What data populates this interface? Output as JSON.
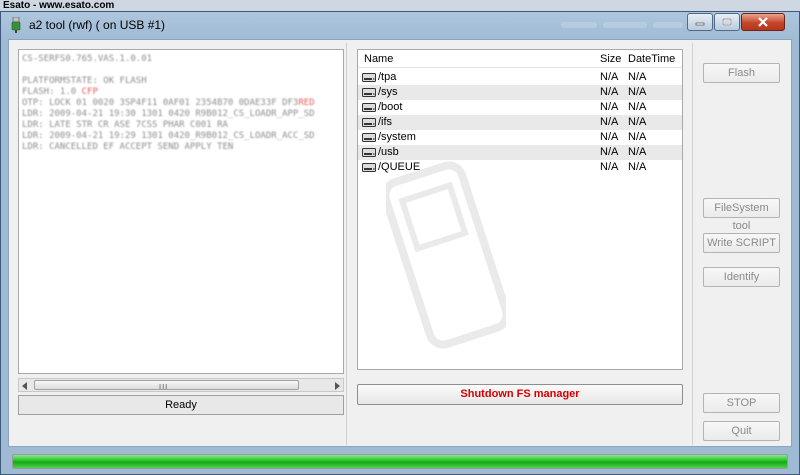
{
  "watermark": "Esato - www.esato.com",
  "window": {
    "title": "a2 tool (rwf) ( on USB #1)",
    "icon": "usb-plug-icon"
  },
  "log": {
    "lines": [
      {
        "text": "CS-SERFS0.765.VAS.1.0.01",
        "red": ""
      },
      {
        "text": "",
        "red": ""
      },
      {
        "text": "PLATFORMSTATE: OK FLASH",
        "red": ""
      },
      {
        "text": "FLASH: 1.0  ",
        "red": "CFP"
      },
      {
        "text": "OTP: LOCK 01 0020 3SP4F11 0AF01 2354B70 0DAE33F DF3",
        "red": "RED"
      },
      {
        "text": "LDR: 2009-04-21 19:30 1301 0420 R9B012_CS_LOADR_APP_SD",
        "red": ""
      },
      {
        "text": "LDR: LATE STR CR  ASE 7CSS PHAR C001  RA",
        "red": ""
      },
      {
        "text": "LDR: 2009-04-21 19:29 1301 0420_R9B012_CS_LOADR_ACC_SD",
        "red": ""
      },
      {
        "text": "LDR: CANCELLED EF ACCEPT SEND APPLY TEN",
        "red": ""
      }
    ],
    "scroll_grip": "III"
  },
  "status": "Ready",
  "filelist": {
    "headers": {
      "name": "Name",
      "size": "Size",
      "datetime": "DateTime"
    },
    "rows": [
      {
        "name": "/tpa",
        "size": "N/A",
        "datetime": "N/A"
      },
      {
        "name": "/sys",
        "size": "N/A",
        "datetime": "N/A"
      },
      {
        "name": "/boot",
        "size": "N/A",
        "datetime": "N/A"
      },
      {
        "name": "/ifs",
        "size": "N/A",
        "datetime": "N/A"
      },
      {
        "name": "/system",
        "size": "N/A",
        "datetime": "N/A"
      },
      {
        "name": "/usb",
        "size": "N/A",
        "datetime": "N/A"
      },
      {
        "name": "/QUEUE",
        "size": "N/A",
        "datetime": "N/A"
      }
    ]
  },
  "shutdown_label": "Shutdown FS manager",
  "buttons": {
    "flash": "Flash",
    "filesystem": "FileSystem tool",
    "write_script": "Write SCRIPT",
    "identify": "Identify",
    "stop": "STOP",
    "quit": "Quit"
  },
  "progress": {
    "percent": 100
  },
  "colors": {
    "progress": "#22c322",
    "shutdown_text": "#d40000",
    "log_red": "#e02020"
  }
}
